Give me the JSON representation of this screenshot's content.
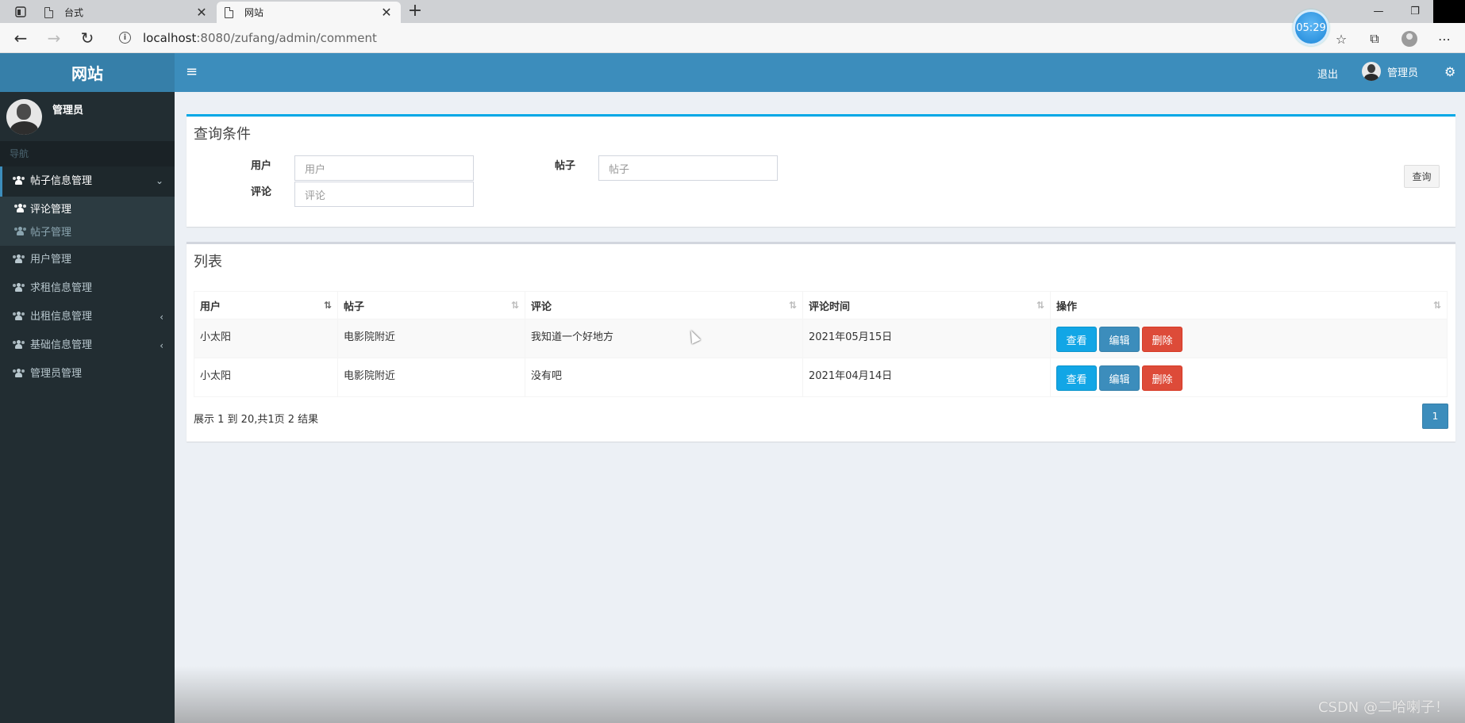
{
  "browser": {
    "tabs": [
      {
        "title": "台式"
      },
      {
        "title": "网站"
      }
    ],
    "url_host": "localhost",
    "url_rest": ":8080/zufang/admin/comment",
    "clock": "05:29"
  },
  "header": {
    "logo": "网站",
    "logout": "退出",
    "user": "管理员"
  },
  "sidebar": {
    "user_name": "管理员",
    "nav_header": "导航",
    "open_group": "帖子信息管理",
    "sub_items": [
      "评论管理",
      "帖子管理"
    ],
    "items": [
      "用户管理",
      "求租信息管理",
      "出租信息管理",
      "基础信息管理",
      "管理员管理"
    ]
  },
  "search": {
    "title": "查询条件",
    "user_label": "用户",
    "user_placeholder": "用户",
    "post_label": "帖子",
    "post_placeholder": "帖子",
    "comment_label": "评论",
    "comment_placeholder": "评论",
    "query_button": "查询"
  },
  "list": {
    "title": "列表",
    "columns": [
      "用户",
      "帖子",
      "评论",
      "评论时间",
      "操作"
    ],
    "rows": [
      {
        "user": "小太阳",
        "post": "电影院附近",
        "comment": "我知道一个好地方",
        "time": "2021年05月15日"
      },
      {
        "user": "小太阳",
        "post": "电影院附近",
        "comment": "没有吧",
        "time": "2021年04月14日"
      }
    ],
    "actions": {
      "view": "查看",
      "edit": "编辑",
      "delete": "删除"
    },
    "pager_info": "展示 1 到 20,共1页 2 结果",
    "page": "1"
  },
  "watermark": "CSDN @二哈喇子！",
  "colors": {
    "header": "#3c8dbc",
    "sidebar": "#222d32",
    "view": "#12a6e6",
    "delete": "#dd4b39"
  }
}
